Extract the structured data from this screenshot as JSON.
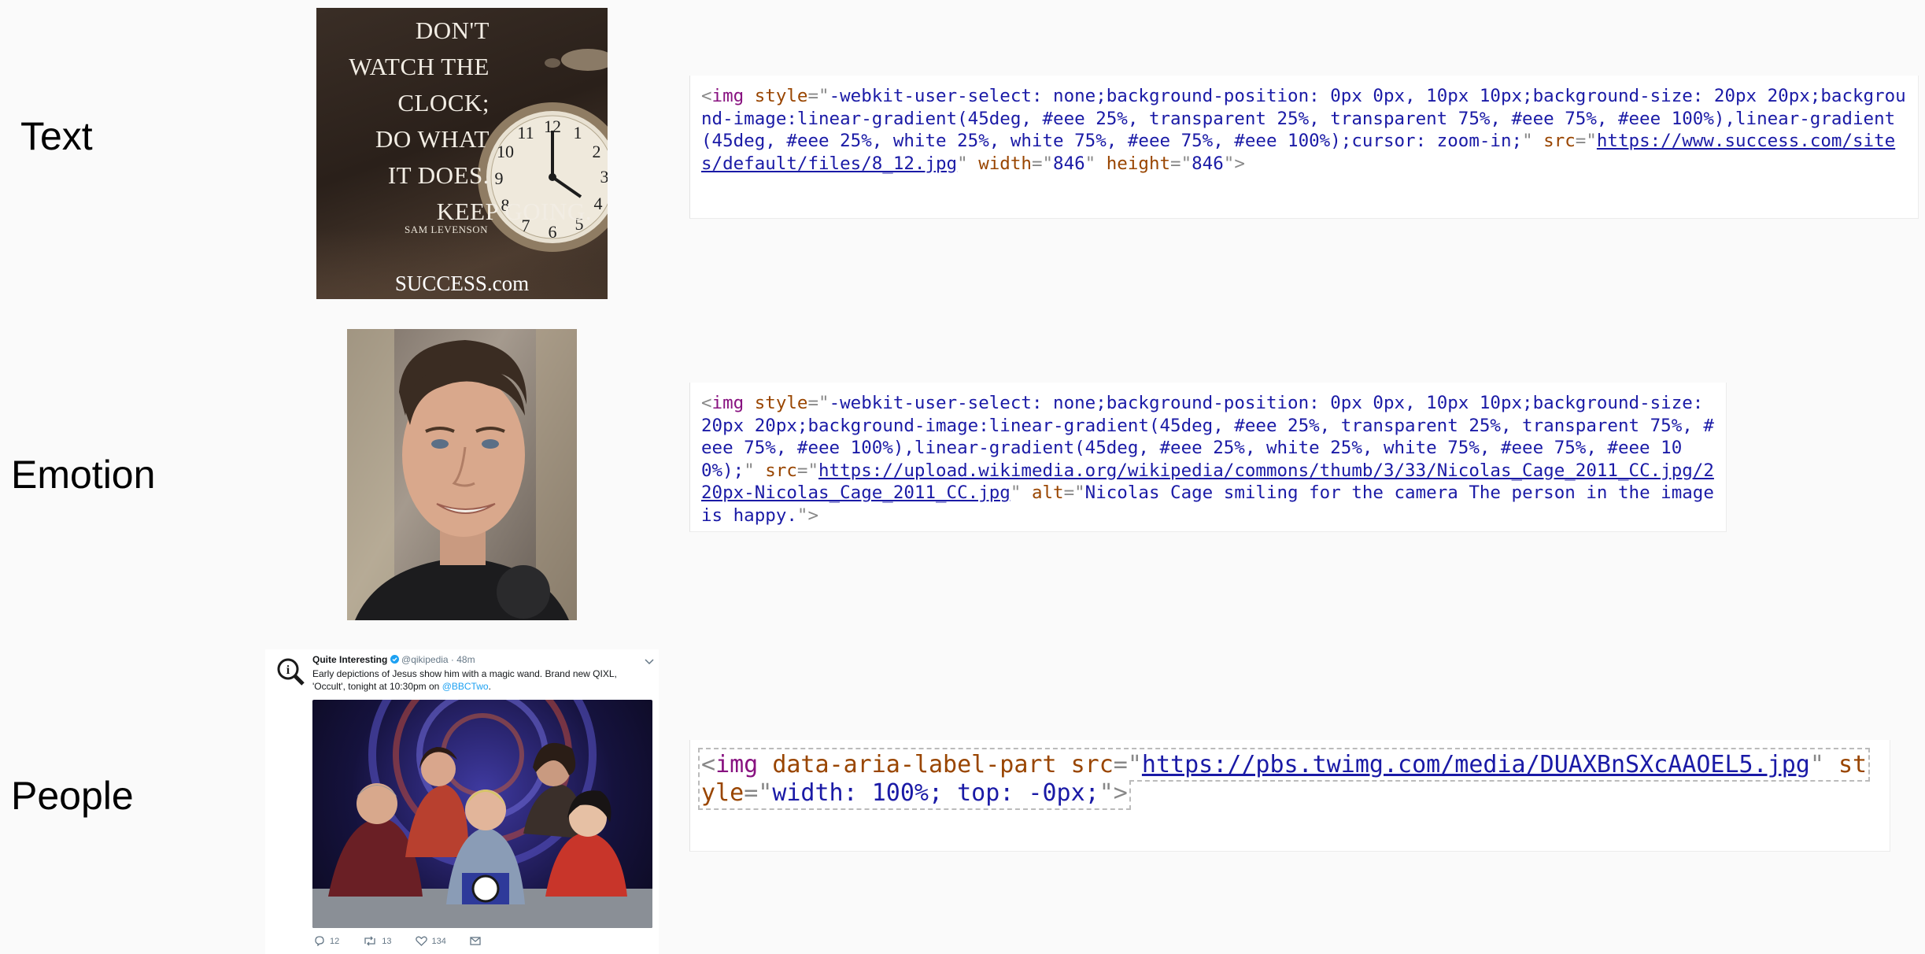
{
  "rows": [
    {
      "label": "Text"
    },
    {
      "label": "Emotion"
    },
    {
      "label": "People"
    }
  ],
  "quote_image": {
    "lines": [
      "DON'T",
      "WATCH THE",
      "CLOCK;",
      "DO WHAT",
      "IT DOES.",
      "KEEP GOING."
    ],
    "author": "SAM LEVENSON",
    "brand": "SUCCESS.com",
    "clock_numerals": [
      "12",
      "1",
      "2",
      "3",
      "4",
      "5",
      "6",
      "7",
      "8",
      "9",
      "10",
      "11"
    ]
  },
  "code_text": {
    "open": "<",
    "tag": "img",
    "attr_style": "style",
    "eq_open": "=\"",
    "style_value": "-webkit-user-select: none;background-position: 0px 0px, 10px 10px;background-size: 20px 20px;background-image:linear-gradient(45deg, #eee 25%, transparent 25%, transparent 75%, #eee 75%, #eee 100%),linear-gradient(45deg, #eee 25%, white 25%, white 75%, #eee 75%, #eee 100%);cursor: zoom-in;",
    "close_q": "\"",
    "attr_src": "src",
    "src_value": "https://www.success.com/sites/default/files/8_12.jpg",
    "attr_width": "width",
    "width_value": "846",
    "attr_height": "height",
    "height_value": "846",
    "end": "\">"
  },
  "code_emotion": {
    "open": "<",
    "tag": "img",
    "attr_style": "style",
    "eq_open": "=\"",
    "style_value": "-webkit-user-select: none;background-position: 0px 0px, 10px 10px;background-size: 20px 20px;background-image:linear-gradient(45deg, #eee 25%, transparent 25%, transparent 75%, #eee 75%, #eee 100%),linear-gradient(45deg, #eee 25%, white 25%, white 75%, #eee 75%, #eee 100%);",
    "close_q": "\"",
    "attr_src": "src",
    "src_value": "https://upload.wikimedia.org/wikipedia/commons/thumb/3/33/Nicolas_Cage_2011_CC.jpg/220px-Nicolas_Cage_2011_CC.jpg",
    "attr_alt": "alt",
    "alt_value": "Nicolas Cage smiling for the camera The person in the image is happy.",
    "end": "\">"
  },
  "code_people": {
    "open": "<",
    "tag": "img",
    "attr_aria": "data-aria-label-part",
    "attr_src": "src",
    "eq_open": "=\"",
    "src_value": "https://pbs.twimg.com/media/DUAXBnSXcAAOEL5.jpg",
    "close_q": "\"",
    "attr_style": "style",
    "style_value": "width: 100%; top: -0px;",
    "end": "\">"
  },
  "tweet": {
    "name": "Quite Interesting",
    "handle": "@qikipedia · 48m",
    "text_before": "Early depictions of Jesus show him with a magic wand.  Brand new QIXL, 'Occult', tonight at 10:30pm on ",
    "mention": "@BBCTwo",
    "text_after": ".",
    "replies": "12",
    "retweets": "13",
    "likes": "134"
  },
  "colors": {
    "tag": "#881280",
    "attr": "#994500",
    "value": "#1a1aa6",
    "punct": "#888888",
    "twitter_blue": "#1da1f2"
  }
}
